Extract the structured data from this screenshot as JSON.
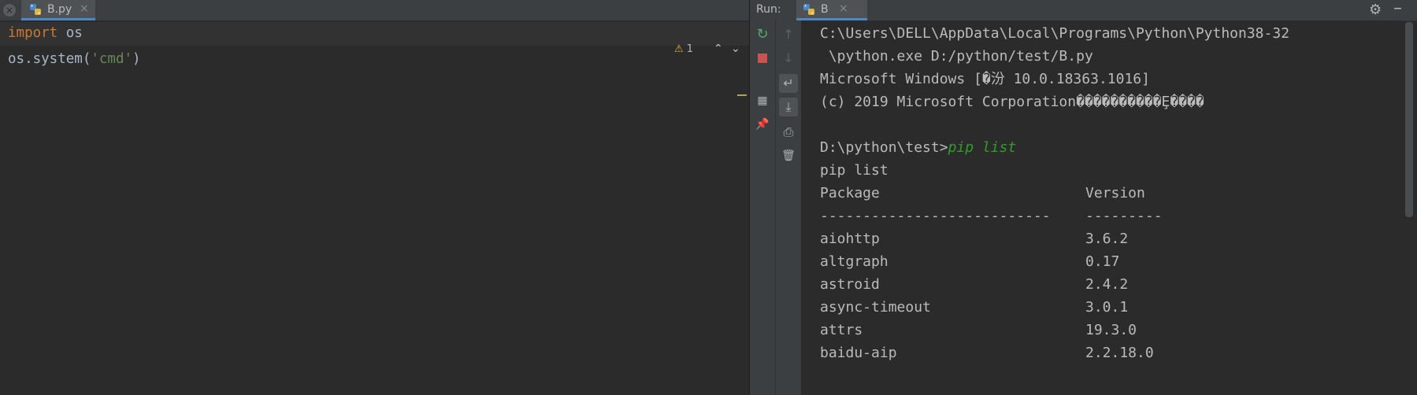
{
  "editor": {
    "tab": {
      "label": "B.py",
      "close_glyph": "×"
    },
    "close_all_glyph": "×",
    "code": {
      "line1": {
        "keyword": "import",
        "rest": " os"
      },
      "line2": {
        "prefix": "os.system(",
        "string": "'cmd'",
        "suffix": ")"
      }
    },
    "inspection": {
      "warning_glyph": "⚠",
      "warning_count": "1",
      "up": "⌃",
      "down": "⌄"
    }
  },
  "run": {
    "title": "Run:",
    "tab": {
      "label": "B",
      "close_glyph": "×"
    },
    "settings_glyph": "⚙",
    "minimize_glyph": "–",
    "toolbar1": [
      "↻",
      "",
      "▦",
      "📌"
    ],
    "toolbar2": [
      "↑",
      "↓",
      "↵",
      "⤓",
      "⎙",
      "🗑"
    ],
    "console": {
      "lines": [
        "C:\\Users\\DELL\\AppData\\Local\\Programs\\Python\\Python38-32",
        " \\python.exe D:/python/test/B.py",
        "Microsoft Windows [�汾 10.0.18363.1016]",
        "(c) 2019 Microsoft Corporation����������Ȩ����",
        "",
        "D:\\python\\test>",
        "pip list"
      ],
      "prompt_input": "pip list",
      "table_header": {
        "package": "Package",
        "version": "Version"
      },
      "table_rule": {
        "package": "---------------------------",
        "version": "---------"
      },
      "packages": [
        {
          "name": "aiohttp",
          "version": "3.6.2"
        },
        {
          "name": "altgraph",
          "version": "0.17"
        },
        {
          "name": "astroid",
          "version": "2.4.2"
        },
        {
          "name": "async-timeout",
          "version": "3.0.1"
        },
        {
          "name": "attrs",
          "version": "19.3.0"
        },
        {
          "name": "baidu-aip",
          "version": "2.2.18.0"
        }
      ]
    }
  },
  "colors": {
    "background": "#2b2b2b",
    "panel": "#3c3f41",
    "keyword": "#cc7832",
    "string": "#6a8759",
    "input_echo": "#339d2b",
    "stop": "#c75450",
    "rerun": "#59a869"
  }
}
